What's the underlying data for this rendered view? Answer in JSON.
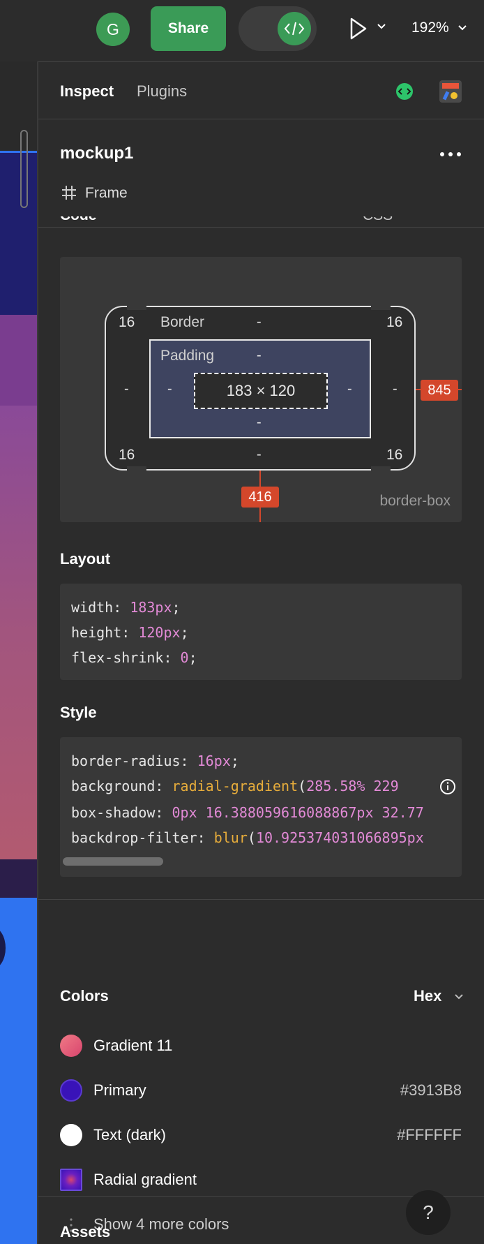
{
  "toolbar": {
    "avatar_initial": "G",
    "share_label": "Share",
    "zoom": "192%"
  },
  "panel": {
    "tabs": [
      "Inspect",
      "Plugins"
    ],
    "frame_name": "mockup1",
    "frame_type": "Frame",
    "cut_row_left": "Code",
    "cut_row_right": "CSS"
  },
  "box_model": {
    "border_label": "Border",
    "padding_label": "Padding",
    "radius_tl": "16",
    "radius_tr": "16",
    "radius_bl": "16",
    "radius_br": "16",
    "dash": "-",
    "size": "183 × 120",
    "offset_right": "845",
    "offset_bottom": "416",
    "box_sizing": "border-box"
  },
  "layout": {
    "title": "Layout",
    "lines": [
      {
        "prop": "width",
        "value": "183px"
      },
      {
        "prop": "height",
        "value": "120px"
      },
      {
        "prop": "flex-shrink",
        "value": "0"
      }
    ]
  },
  "style": {
    "title": "Style",
    "border_radius_prop": "border-radius",
    "border_radius_value": "16px",
    "background_prop": "background",
    "background_fn": "radial-gradient",
    "background_args": "285.58% 229",
    "box_shadow_prop": "box-shadow",
    "box_shadow_value": "0px 16.388059616088867px 32.77",
    "backdrop_prop": "backdrop-filter",
    "backdrop_fn": "blur",
    "backdrop_args": "10.925374031066895px"
  },
  "colors": {
    "title": "Colors",
    "format": "Hex",
    "items": [
      {
        "name": "Gradient 11",
        "hex": "",
        "swatch": "#e8607a"
      },
      {
        "name": "Primary",
        "hex": "#3913B8",
        "swatch": "#3913B8"
      },
      {
        "name": "Text (dark)",
        "hex": "#FFFFFF",
        "swatch": "#FFFFFF"
      },
      {
        "name": "Radial gradient",
        "hex": "",
        "swatch": "#3913B8"
      }
    ],
    "more_label": "Show 4 more colors"
  },
  "assets": {
    "title": "Assets"
  },
  "help_label": "?",
  "theme": {
    "accent_green": "#3a9b57",
    "badge_red": "#d4472b",
    "canvas_blue": "#2f73f0"
  }
}
